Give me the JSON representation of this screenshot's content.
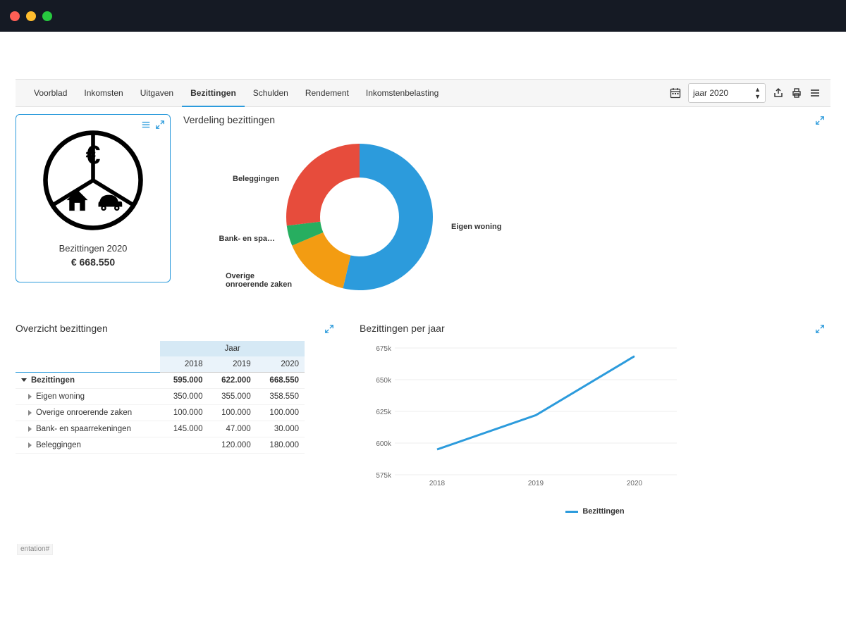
{
  "tabs": [
    "Voorblad",
    "Inkomsten",
    "Uitgaven",
    "Bezittingen",
    "Schulden",
    "Rendement",
    "Inkomstenbelasting"
  ],
  "active_tab": "Bezittingen",
  "year_select": "jaar 2020",
  "card": {
    "label": "Bezittingen  2020",
    "value": "€ 668.550"
  },
  "donut_title": "Verdeling bezittingen",
  "donut_labels": {
    "beleggingen": "Beleggingen",
    "bank": "Bank- en spa…",
    "overige": "Overige\nonroerende zaken",
    "eigen": "Eigen woning"
  },
  "overzicht_title": "Overzicht bezittingen",
  "table_header_group": "Jaar",
  "table_years": [
    "2018",
    "2019",
    "2020"
  ],
  "table_rows": [
    {
      "label": "Bezittingen",
      "v": [
        "595.000",
        "622.000",
        "668.550"
      ],
      "total": true
    },
    {
      "label": "Eigen woning",
      "v": [
        "350.000",
        "355.000",
        "358.550"
      ]
    },
    {
      "label": "Overige onroerende zaken",
      "v": [
        "100.000",
        "100.000",
        "100.000"
      ]
    },
    {
      "label": "Bank- en spaarrekeningen",
      "v": [
        "145.000",
        "47.000",
        "30.000"
      ]
    },
    {
      "label": "Beleggingen",
      "v": [
        "",
        "120.000",
        "180.000"
      ]
    }
  ],
  "line_title": "Bezittingen per jaar",
  "line_legend": "Bezittingen",
  "line_yticks": [
    "675k",
    "650k",
    "625k",
    "600k",
    "575k"
  ],
  "line_xticks": [
    "2018",
    "2019",
    "2020"
  ],
  "footer": "entation#",
  "chart_data": [
    {
      "type": "pie",
      "title": "Verdeling bezittingen",
      "series": [
        {
          "name": "Eigen woning",
          "value": 358550,
          "color": "#2c9bdc"
        },
        {
          "name": "Overige onroerende zaken",
          "value": 100000,
          "color": "#f39c12"
        },
        {
          "name": "Bank- en spaarrekeningen",
          "value": 30000,
          "color": "#27ae60"
        },
        {
          "name": "Beleggingen",
          "value": 180000,
          "color": "#e74c3c"
        }
      ]
    },
    {
      "type": "line",
      "title": "Bezittingen per jaar",
      "x": [
        "2018",
        "2019",
        "2020"
      ],
      "series": [
        {
          "name": "Bezittingen",
          "values": [
            595000,
            622000,
            668550
          ],
          "color": "#2c9bdc"
        }
      ],
      "ylim": [
        575000,
        675000
      ],
      "ylabel": "",
      "xlabel": ""
    },
    {
      "type": "table",
      "title": "Overzicht bezittingen",
      "columns": [
        "",
        "2018",
        "2019",
        "2020"
      ],
      "rows": [
        [
          "Bezittingen",
          595000,
          622000,
          668550
        ],
        [
          "Eigen woning",
          350000,
          355000,
          358550
        ],
        [
          "Overige onroerende zaken",
          100000,
          100000,
          100000
        ],
        [
          "Bank- en spaarrekeningen",
          145000,
          47000,
          30000
        ],
        [
          "Beleggingen",
          null,
          120000,
          180000
        ]
      ]
    }
  ]
}
